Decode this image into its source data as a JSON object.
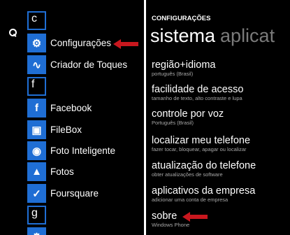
{
  "left_panel": {
    "letters": [
      "c",
      "f",
      "g"
    ],
    "apps": [
      {
        "name": "Configurações",
        "icon": "gear-icon",
        "glyph": "⚙"
      },
      {
        "name": "Criador de Toques",
        "icon": "sound-wave-icon",
        "glyph": "∿"
      },
      {
        "name": "Facebook",
        "icon": "facebook-icon",
        "glyph": "f"
      },
      {
        "name": "FileBox",
        "icon": "filebox-icon",
        "glyph": "▣"
      },
      {
        "name": "Foto Inteligente",
        "icon": "camera-icon",
        "glyph": "◉"
      },
      {
        "name": "Fotos",
        "icon": "photos-icon",
        "glyph": "▲"
      },
      {
        "name": "Foursquare",
        "icon": "foursquare-icon",
        "glyph": "✓"
      }
    ]
  },
  "right_panel": {
    "header": "CONFIGURAÇÕES",
    "pivot_active": "sistema",
    "pivot_next": "aplicat",
    "items": [
      {
        "title": "região+idioma",
        "subtitle": "português (Brasil)"
      },
      {
        "title": "facilidade de acesso",
        "subtitle": "tamanho de texto, alto contraste e lupa"
      },
      {
        "title": "controle por voz",
        "subtitle": "Português (Brasil)"
      },
      {
        "title": "localizar meu telefone",
        "subtitle": "fazer tocar, bloquear, apagar ou localizar"
      },
      {
        "title": "atualização do telefone",
        "subtitle": "obter atualizações de software"
      },
      {
        "title": "aplicativos da empresa",
        "subtitle": "adicionar uma conta de empresa"
      },
      {
        "title": "sobre",
        "subtitle": "Windows Phone"
      }
    ]
  },
  "colors": {
    "accent": "#1f6ed4",
    "arrow": "#c8171e"
  }
}
